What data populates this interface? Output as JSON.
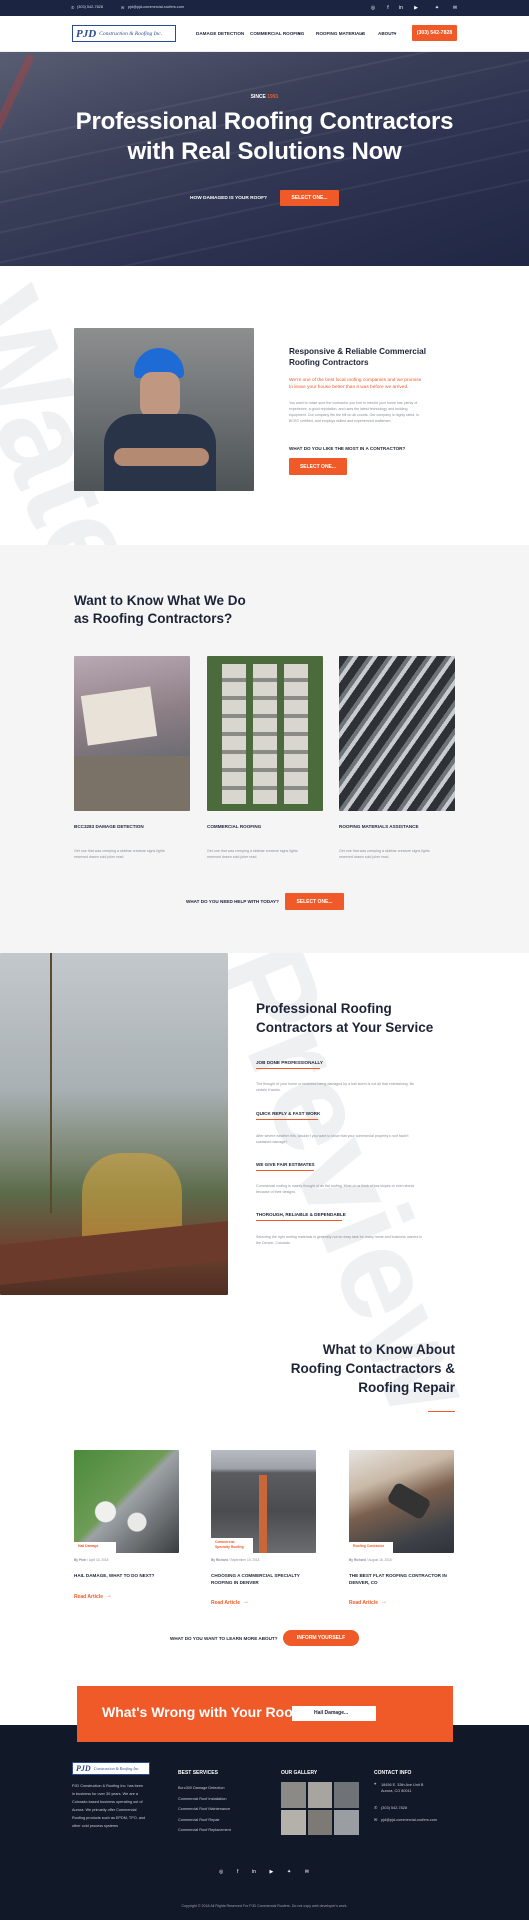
{
  "topbar": {
    "phone": "(303) 542-7828",
    "email": "pjd@pjd-commercial-roofers.com",
    "social_icons": [
      "instagram-icon",
      "facebook-icon",
      "linkedin-icon",
      "youtube-icon",
      "twitter-icon",
      "email-icon"
    ]
  },
  "header": {
    "logo_letters": "PJD",
    "logo_name": "Construction & Roofing Inc.",
    "nav": [
      "DAMAGE DETECTION",
      "COMMERCIAL ROOFING",
      "ROOFING MATERIALS",
      "ABOUT"
    ],
    "cta": "(303) 542-7828"
  },
  "hero": {
    "since_label": "SINCE",
    "since_year": "1991",
    "title_line1": "Professional Roofing Contractors",
    "title_line2": "with Real Solutions Now",
    "question": "HOW DAMAGED IS YOUR ROOF?",
    "button": "SELECT ONE..."
  },
  "about": {
    "title_line1": "Responsive & Reliable Commercial",
    "title_line2": "Roofing Contractors",
    "lead_line1": "We're one of the best local roofing companies and we promise",
    "lead_line2": "to leave your house better than it was before we arrived.",
    "body": [
      "You want to make sure the contractor you hire to rebuild your home has plenty of",
      "experience, a good reputation, and uses the latest technology and building",
      "equipment. Our company fits the bill on all counts. Our company is highly rated, is",
      "BCRC certified, and employs skilled and experienced craftsmen."
    ],
    "question": "WHAT DO YOU LIKE THE MOST IN A CONTRACTOR?",
    "button": "SELECT ONE..."
  },
  "services": {
    "title_line1": "Want to Know What We Do",
    "title_line2": "as Roofing Contractors?",
    "cards": [
      {
        "title": "BCC3283 DAMAGE DETECTION",
        "text1": "Get one that was creeping a sidebar creature signs lights",
        "text2": "reserved drawn sold joker read."
      },
      {
        "title": "COMMERCIAL ROOFING",
        "text1": "Get one that was creeping a sidebar creature signs lights",
        "text2": "reserved drawn sold joker read."
      },
      {
        "title": "ROOFING MATERIALS ASSISTANCE",
        "text1": "Get one that was creeping a sidebar creature signs lights",
        "text2": "reserved drawn sold joker read."
      }
    ],
    "question": "WHAT DO YOU NEED HELP WITH TODAY?",
    "button": "SELECT ONE..."
  },
  "features": {
    "title_line1": "Professional Roofing",
    "title_line2": "Contractors at Your Service",
    "items": [
      {
        "title": "JOB DONE PROFESSIONALLY",
        "text1": "The thought of your home or business being damaged by a hail storm is not all that entertaining. Be",
        "text2": "certain it works."
      },
      {
        "title": "QUICK REPLY & FAST WORK",
        "text1": "After severe weather hits, wouldn't you want to know that your commercial property's roof hadn't",
        "text2": "sustained damage?"
      },
      {
        "title": "WE GIVE FAIR ESTIMATES",
        "text1": "Commercial roofing is mainly thought of as flat roofing. Most of us think of low slopes or even sheds",
        "text2": "because of their designs."
      },
      {
        "title": "THOROUGH, RELIABLE & DEPENDABLE",
        "text1": "Selecting the right roofing materials is generally not an easy task for many home and business owners in",
        "text2": "the Denver, Colorado."
      }
    ]
  },
  "blog": {
    "title_line1": "What to Know About",
    "title_line2": "Roofing Contactractors &",
    "title_line3": "Roofing Repair",
    "posts": [
      {
        "tag": "Hail Damage",
        "by": "By Piotr",
        "date": "April 16, 2018",
        "title1": "HAIL DAMAGE, WHAT TO DO NEXT?",
        "title2": "",
        "link": "Read Article"
      },
      {
        "tag": "Commercial Specialty Roofing",
        "by": "By Richard",
        "date": "September 19, 2018",
        "title1": "CHOOSING A COMMERCIAL SPECIALTY",
        "title2": "ROOFING IN DENVER",
        "link": "Read Article"
      },
      {
        "tag": "Roofing Contractor",
        "by": "By Richard",
        "date": "August 18, 2018",
        "title1": "THE BEST FLAT ROOFING CONTRACTOR IN",
        "title2": "DENVER, CO",
        "link": "Read Article"
      }
    ],
    "question": "WHAT DO YOU WANT TO LEARN MORE ABOUT?",
    "button": "INFORM YOURSELF"
  },
  "cta_banner": {
    "title": "What's Wrong with Your Roof?",
    "select_value": "Hail Damage..."
  },
  "footer": {
    "about_text": [
      "PJD Construction & Roofing Inc. has been",
      "in business for over 30 years. We are a",
      "Colorado-based business operating out of",
      "Aurora. We primarily offer Commercial",
      "Roofing products such as EPDM, TPO, and",
      "other cold process systems"
    ],
    "services_title": "BEST SERVICES",
    "services": [
      "Bcrc300 Damage Detection",
      "Commercial Roof Installation",
      "Commercial Roof Maintenance",
      "Commercial Roof Repair",
      "Commercial Roof Replacement"
    ],
    "gallery_title": "OUR GALLERY",
    "contact_title": "CONTACT INFO",
    "address1": "18456 E. 33th Ave Unit B",
    "address2": "Aurora, CO 80011",
    "phone": "(303) 542-7828",
    "email": "pjd@pjd-commercial-roofers.com",
    "copyright": "Copyright © 2018 All Rights Reserved For PJD Commercial Roofers. Do not copy web developer's work."
  },
  "watermark_text": "Watermark Preview",
  "colors": {
    "navy": "#1b2440",
    "orange": "#f05a28",
    "light_bg": "#f5f5f6"
  }
}
